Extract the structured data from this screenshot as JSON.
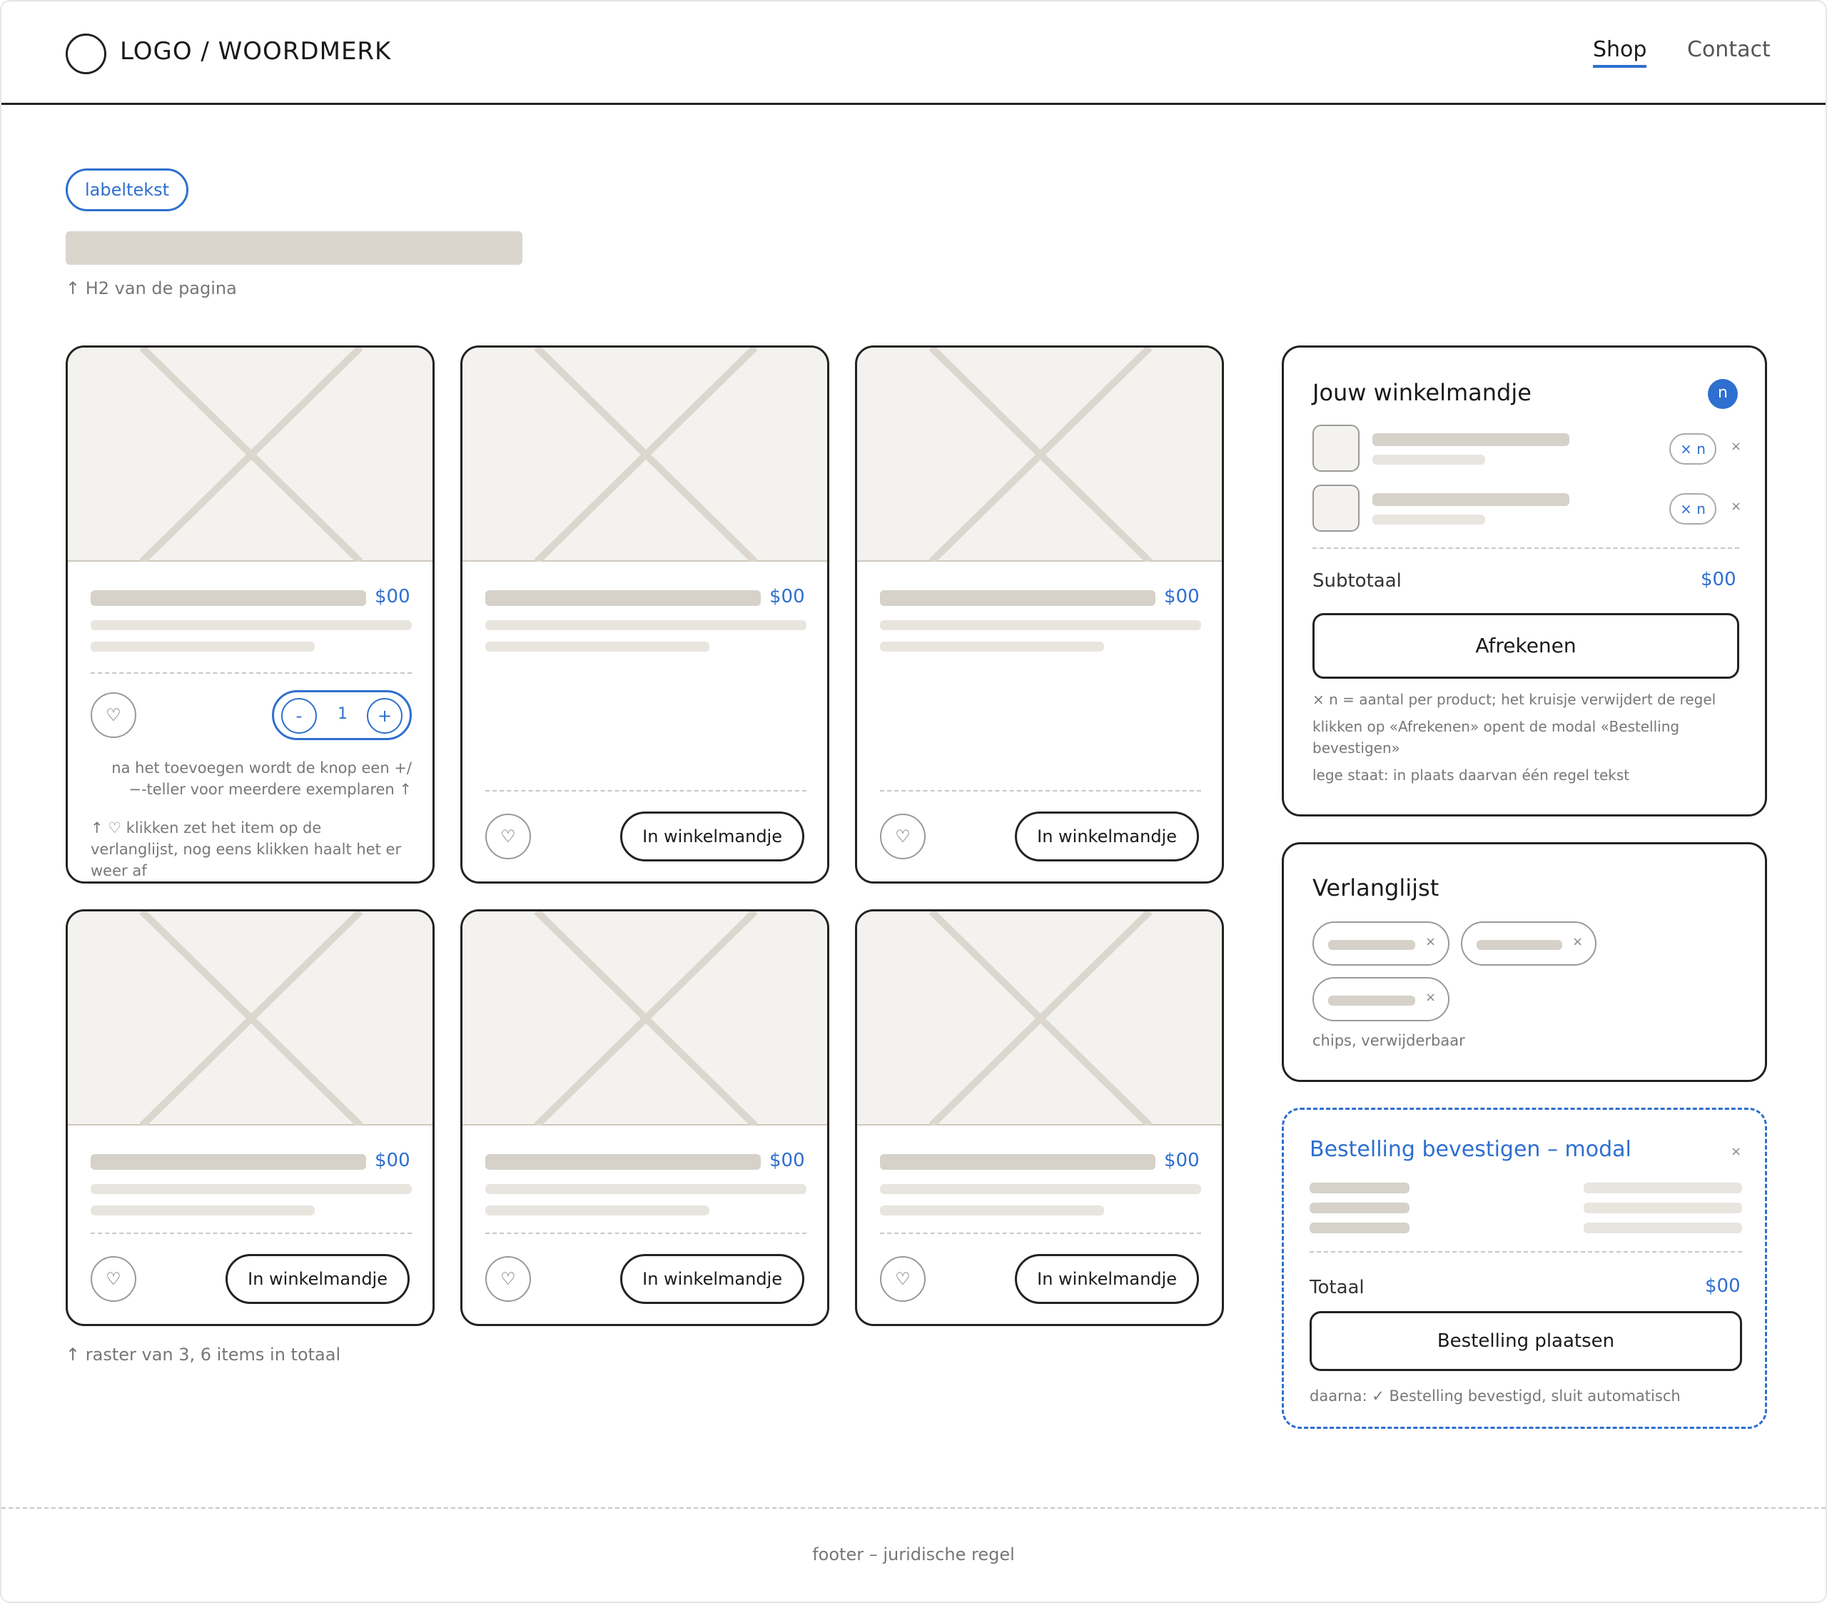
{
  "header": {
    "logo_text": "LOGO / WOORDMERK",
    "nav": {
      "shop": "Shop",
      "contact": "Contact"
    }
  },
  "page": {
    "label": "labeltekst",
    "h2_note": "↑ H2 van de pagina",
    "grid_note": "↑ raster van 3, 6 items in totaal"
  },
  "products": {
    "price": "$00",
    "add_label": "In winkelmandje",
    "heart_icon": "heart-icon",
    "stepper": {
      "minus": "-",
      "value": "1",
      "plus": "+"
    },
    "note_stepper": "na het toevoegen wordt de knop een +/−-teller voor meerdere exemplaren ↑",
    "note_wishlist": "↑ ♡ klikken zet het item op de verlanglijst, nog eens klikken haalt het er weer af"
  },
  "cart": {
    "title": "Jouw winkelmandje",
    "badge": "n",
    "qty_label": "× n",
    "remove_label": "×",
    "subtotal_label": "Subtotaal",
    "subtotal_value": "$00",
    "checkout_label": "Afrekenen",
    "note_1": "× n = aantal per product; het kruisje verwijdert de regel",
    "note_2": "klikken op «Afrekenen» opent de modal «Bestelling bevestigen»",
    "note_3": "lege staat: in plaats daarvan één regel tekst"
  },
  "wishlist": {
    "title": "Verlanglijst",
    "chip_remove": "×",
    "note": "chips, verwijderbaar"
  },
  "modal": {
    "title": "Bestelling bevestigen – modal",
    "close": "×",
    "total_label": "Totaal",
    "total_value": "$00",
    "place_label": "Bestelling plaatsen",
    "note": "daarna: ✓ Bestelling bevestigd, sluit automatisch"
  },
  "footer": {
    "text": "footer – juridische regel"
  },
  "colors": {
    "accent": "#2e6fcf",
    "placeholder": "#d6d1c9",
    "image_bg": "#f3f2ee"
  }
}
